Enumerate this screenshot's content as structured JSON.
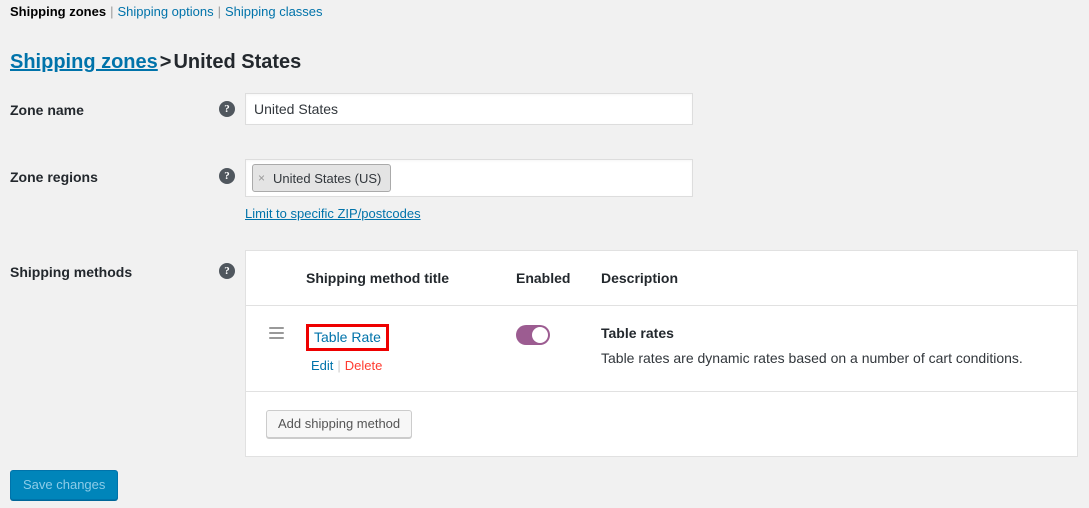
{
  "subnav": {
    "items": [
      {
        "label": "Shipping zones",
        "active": true
      },
      {
        "label": "Shipping options",
        "active": false
      },
      {
        "label": "Shipping classes",
        "active": false
      }
    ],
    "separator": "|"
  },
  "breadcrumb": {
    "parent": "Shipping zones",
    "separator": ">",
    "current": "United States"
  },
  "form": {
    "zone_name": {
      "label": "Zone name",
      "help": "?",
      "value": "United States",
      "placeholder": "Zone name"
    },
    "zone_regions": {
      "label": "Zone regions",
      "help": "?",
      "chips": [
        {
          "remove": "×",
          "label": "United States (US)"
        }
      ],
      "zip_link": "Limit to specific ZIP/postcodes"
    },
    "shipping_methods": {
      "label": "Shipping methods",
      "help": "?"
    }
  },
  "methods_table": {
    "columns": {
      "handle": "",
      "title": "Shipping method title",
      "enabled": "Enabled",
      "description": "Description"
    },
    "rows": [
      {
        "handle_icon": "drag-handle-icon",
        "title": "Table Rate",
        "highlighted": true,
        "actions": {
          "edit": "Edit",
          "separator": "|",
          "delete": "Delete"
        },
        "enabled": true,
        "desc_title": "Table rates",
        "desc_text": "Table rates are dynamic rates based on a number of cart conditions."
      }
    ],
    "add_method_button": "Add shipping method"
  },
  "footer": {
    "save_button": "Save changes"
  },
  "colors": {
    "link": "#0073aa",
    "delete": "#ff3b30",
    "toggle_on": "#9c5c91",
    "primary_button": "#0085ba",
    "highlight_outline": "#ee0000",
    "page_background": "#f1f1f1"
  }
}
